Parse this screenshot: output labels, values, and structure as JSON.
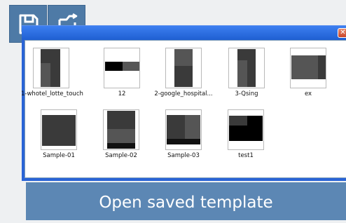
{
  "toolbar": {
    "save_icon": "save-icon",
    "open_icon": "open-file-icon",
    "button_color": "#4e7aa6"
  },
  "dialog": {
    "close_glyph": "✕",
    "items": [
      {
        "label": "1-whotel_lotte_touch"
      },
      {
        "label": "12"
      },
      {
        "label": "2-google_hospital..."
      },
      {
        "label": "3-Qsing"
      },
      {
        "label": "ex"
      },
      {
        "label": "Sample-01"
      },
      {
        "label": "Sample-02"
      },
      {
        "label": "Sample-03"
      },
      {
        "label": "test1"
      }
    ]
  },
  "caption": {
    "text": "Open saved template",
    "color": "#5c87b4"
  }
}
